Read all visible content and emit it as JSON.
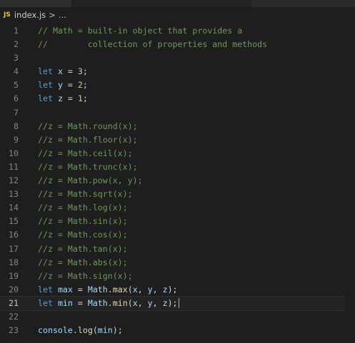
{
  "breadcrumb": {
    "file_icon": "JS",
    "file": "index.js",
    "separator": ">",
    "more": "..."
  },
  "editor": {
    "current_line": 21,
    "lines": [
      {
        "n": "1",
        "tokens": [
          {
            "t": "// Math = built-in object that provides a",
            "c": "comment"
          }
        ]
      },
      {
        "n": "2",
        "tokens": [
          {
            "t": "//        collection of properties and methods",
            "c": "comment"
          }
        ]
      },
      {
        "n": "3",
        "tokens": []
      },
      {
        "n": "4",
        "tokens": [
          {
            "t": "let",
            "c": "kw"
          },
          {
            "t": " ",
            "c": "op"
          },
          {
            "t": "x",
            "c": "var"
          },
          {
            "t": " = ",
            "c": "op"
          },
          {
            "t": "3",
            "c": "num"
          },
          {
            "t": ";",
            "c": "punc"
          }
        ]
      },
      {
        "n": "5",
        "tokens": [
          {
            "t": "let",
            "c": "kw"
          },
          {
            "t": " ",
            "c": "op"
          },
          {
            "t": "y",
            "c": "var"
          },
          {
            "t": " = ",
            "c": "op"
          },
          {
            "t": "2",
            "c": "num"
          },
          {
            "t": ";",
            "c": "punc"
          }
        ]
      },
      {
        "n": "6",
        "tokens": [
          {
            "t": "let",
            "c": "kw"
          },
          {
            "t": " ",
            "c": "op"
          },
          {
            "t": "z",
            "c": "var"
          },
          {
            "t": " = ",
            "c": "op"
          },
          {
            "t": "1",
            "c": "num"
          },
          {
            "t": ";",
            "c": "punc"
          }
        ]
      },
      {
        "n": "7",
        "tokens": []
      },
      {
        "n": "8",
        "tokens": [
          {
            "t": "//z = Math.round(x);",
            "c": "comment"
          }
        ]
      },
      {
        "n": "9",
        "tokens": [
          {
            "t": "//z = Math.floor(x);",
            "c": "comment"
          }
        ]
      },
      {
        "n": "10",
        "tokens": [
          {
            "t": "//z = Math.ceil(x);",
            "c": "comment"
          }
        ]
      },
      {
        "n": "11",
        "tokens": [
          {
            "t": "//z = Math.trunc(x);",
            "c": "comment"
          }
        ]
      },
      {
        "n": "12",
        "tokens": [
          {
            "t": "//z = Math.pow(x, y);",
            "c": "comment"
          }
        ]
      },
      {
        "n": "13",
        "tokens": [
          {
            "t": "//z = Math.sqrt(x);",
            "c": "comment"
          }
        ]
      },
      {
        "n": "14",
        "tokens": [
          {
            "t": "//z = Math.log(x);",
            "c": "comment"
          }
        ]
      },
      {
        "n": "15",
        "tokens": [
          {
            "t": "//z = Math.sin(x);",
            "c": "comment"
          }
        ]
      },
      {
        "n": "16",
        "tokens": [
          {
            "t": "//z = Math.cos(x);",
            "c": "comment"
          }
        ]
      },
      {
        "n": "17",
        "tokens": [
          {
            "t": "//z = Math.tan(x);",
            "c": "comment"
          }
        ]
      },
      {
        "n": "18",
        "tokens": [
          {
            "t": "//z = Math.abs(x);",
            "c": "comment"
          }
        ]
      },
      {
        "n": "19",
        "tokens": [
          {
            "t": "//z = Math.sign(x);",
            "c": "comment"
          }
        ]
      },
      {
        "n": "20",
        "tokens": [
          {
            "t": "let",
            "c": "kw"
          },
          {
            "t": " ",
            "c": "op"
          },
          {
            "t": "max",
            "c": "var"
          },
          {
            "t": " = ",
            "c": "op"
          },
          {
            "t": "Math",
            "c": "obj"
          },
          {
            "t": ".",
            "c": "punc"
          },
          {
            "t": "max",
            "c": "fn"
          },
          {
            "t": "(",
            "c": "punc"
          },
          {
            "t": "x",
            "c": "var"
          },
          {
            "t": ", ",
            "c": "punc"
          },
          {
            "t": "y",
            "c": "var"
          },
          {
            "t": ", ",
            "c": "punc"
          },
          {
            "t": "z",
            "c": "var"
          },
          {
            "t": ");",
            "c": "punc"
          }
        ]
      },
      {
        "n": "21",
        "tokens": [
          {
            "t": "let",
            "c": "kw"
          },
          {
            "t": " ",
            "c": "op"
          },
          {
            "t": "min",
            "c": "var"
          },
          {
            "t": " = ",
            "c": "op"
          },
          {
            "t": "Math",
            "c": "obj"
          },
          {
            "t": ".",
            "c": "punc"
          },
          {
            "t": "min",
            "c": "fn"
          },
          {
            "t": "(",
            "c": "punc"
          },
          {
            "t": "x",
            "c": "var"
          },
          {
            "t": ", ",
            "c": "punc"
          },
          {
            "t": "y",
            "c": "var"
          },
          {
            "t": ", ",
            "c": "punc"
          },
          {
            "t": "z",
            "c": "var"
          },
          {
            "t": ");",
            "c": "punc"
          }
        ]
      },
      {
        "n": "22",
        "tokens": []
      },
      {
        "n": "23",
        "tokens": [
          {
            "t": "console",
            "c": "var"
          },
          {
            "t": ".",
            "c": "punc"
          },
          {
            "t": "log",
            "c": "fn"
          },
          {
            "t": "(",
            "c": "punc"
          },
          {
            "t": "min",
            "c": "var"
          },
          {
            "t": ");",
            "c": "punc"
          }
        ]
      }
    ]
  },
  "colors": {
    "background": "#1e1e1e",
    "comment": "#6a9955",
    "keyword": "#569cd6",
    "variable": "#9cdcfe",
    "number": "#b5cea8",
    "function": "#dcdcaa",
    "js_badge": "#e8c93a"
  }
}
